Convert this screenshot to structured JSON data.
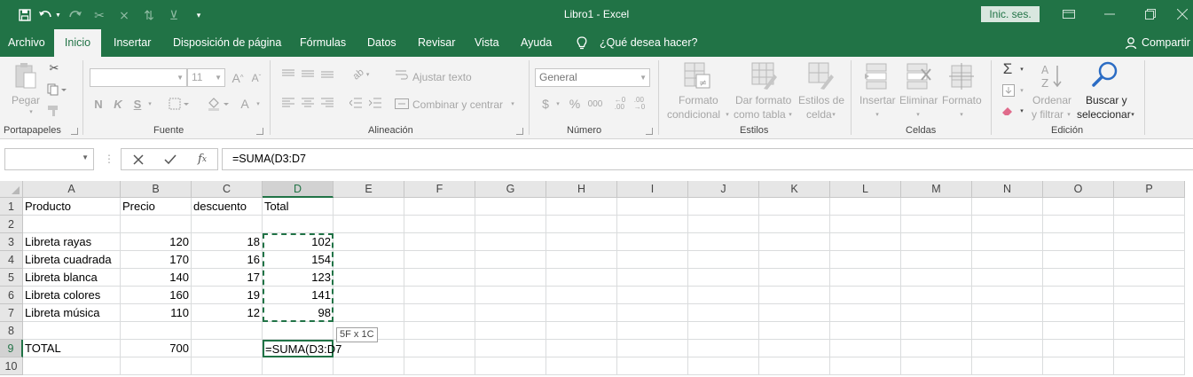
{
  "window": {
    "title": "Libro1  -  Excel",
    "sign_in": "Inic. ses.",
    "colors": {
      "brand": "#217346",
      "ribbon_bg": "#f3f3f3",
      "grid_line": "#dadcdd"
    }
  },
  "quick_access": [
    "save-icon",
    "undo-icon",
    "redo-icon",
    "cut-scissor-icon",
    "clear-icon",
    "sort-icon",
    "customize-icon"
  ],
  "tabs": [
    "Archivo",
    "Inicio",
    "Insertar",
    "Disposición de página",
    "Fórmulas",
    "Datos",
    "Revisar",
    "Vista",
    "Ayuda"
  ],
  "active_tab": "Inicio",
  "tell_me": "¿Qué desea hacer?",
  "share": "Compartir",
  "ribbon": {
    "clipboard": {
      "label": "Portapapeles",
      "paste": "Pegar"
    },
    "font": {
      "label": "Fuente",
      "size": "11",
      "bold": "N",
      "italic": "K",
      "underline": "S",
      "font_color": "A"
    },
    "alignment": {
      "label": "Alineación",
      "wrap": "Ajustar texto",
      "merge": "Combinar y centrar"
    },
    "number": {
      "label": "Número",
      "format": "General",
      "currency": "$",
      "percent": "%",
      "thousands": "000"
    },
    "styles": {
      "label": "Estilos",
      "conditional_l1": "Formato",
      "conditional_l2": "condicional",
      "table_l1": "Dar formato",
      "table_l2": "como tabla",
      "cell_styles_l1": "Estilos de",
      "cell_styles_l2": "celda"
    },
    "cells": {
      "label": "Celdas",
      "insert": "Insertar",
      "delete": "Eliminar",
      "format": "Formato"
    },
    "editing": {
      "label": "Edición",
      "sort_l1": "Ordenar",
      "sort_l2": "y filtrar",
      "find_l1": "Buscar y",
      "find_l2": "seleccionar"
    }
  },
  "formula_bar": {
    "name_box": "",
    "formula": "=SUMA(D3:D7"
  },
  "sheet": {
    "columns": [
      "A",
      "B",
      "C",
      "D",
      "E",
      "F",
      "G",
      "H",
      "I",
      "J",
      "K",
      "L",
      "M",
      "N",
      "O",
      "P"
    ],
    "rows": [
      "1",
      "2",
      "3",
      "4",
      "5",
      "6",
      "7",
      "8",
      "9",
      "10"
    ],
    "data": [
      [
        "Producto",
        "Precio",
        "descuento",
        "Total"
      ],
      [
        "",
        "",
        "",
        ""
      ],
      [
        "Libreta rayas",
        "120",
        "18",
        "102"
      ],
      [
        "Libreta cuadrada",
        "170",
        "16",
        "154"
      ],
      [
        "Libreta blanca",
        "140",
        "17",
        "123"
      ],
      [
        "Libreta colores",
        "160",
        "19",
        "141"
      ],
      [
        "Libreta música",
        "110",
        "12",
        "98"
      ],
      [
        "",
        "",
        "",
        ""
      ],
      [
        "TOTAL",
        "700",
        "",
        "=SUMA(D3:D7"
      ],
      [
        "",
        "",
        "",
        ""
      ]
    ],
    "selection_tip": "5F x 1C"
  }
}
